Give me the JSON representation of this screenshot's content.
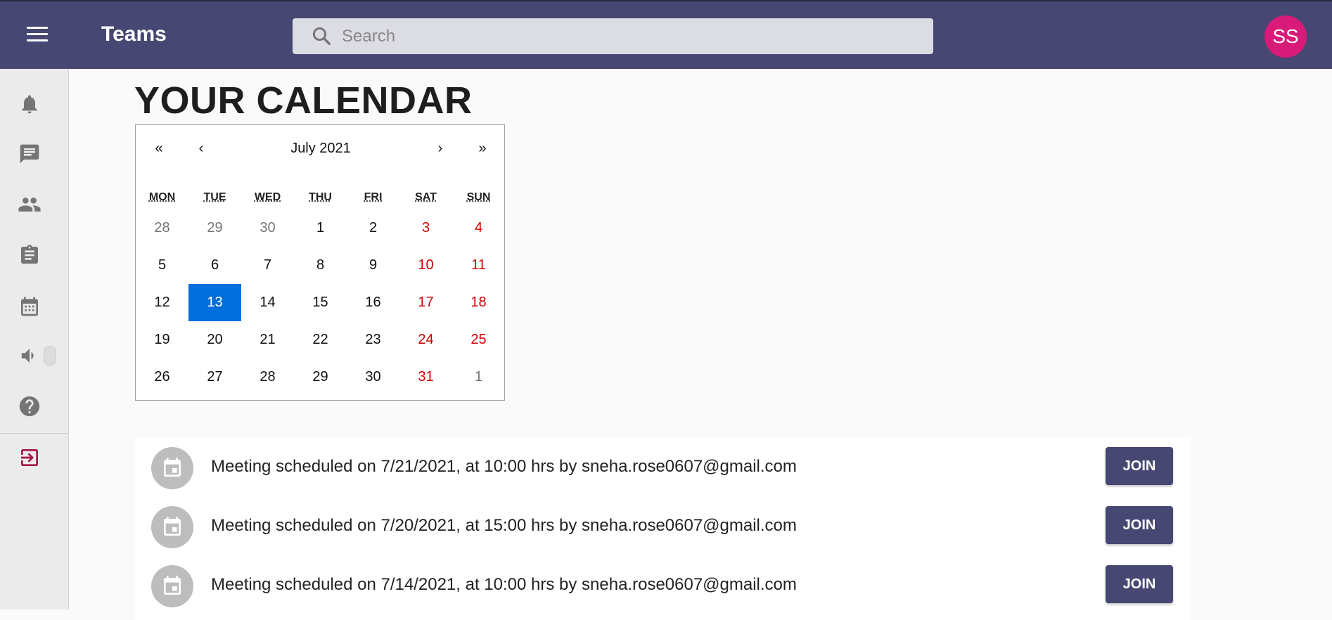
{
  "header": {
    "app_title": "Teams",
    "search_placeholder": "Search",
    "avatar_initials": "SS",
    "bar_color": "#474773",
    "avatar_color": "#d81b78"
  },
  "sidebar": {
    "items": [
      {
        "icon": "bell-icon"
      },
      {
        "icon": "chat-icon"
      },
      {
        "icon": "people-icon"
      },
      {
        "icon": "clipboard-icon"
      },
      {
        "icon": "calendar-icon"
      },
      {
        "icon": "speaker-icon",
        "toggle": "off"
      },
      {
        "icon": "help-icon"
      },
      {
        "icon": "logout-icon",
        "color": "#a31545"
      }
    ]
  },
  "main": {
    "page_title": "YOUR CALENDAR"
  },
  "calendar": {
    "prev_year": "«",
    "prev_month": "‹",
    "month_label": "July 2021",
    "next_month": "›",
    "next_year": "»",
    "weekdays": [
      "MON",
      "TUE",
      "WED",
      "THU",
      "FRI",
      "SAT",
      "SUN"
    ],
    "days": [
      {
        "n": "28",
        "muted": true
      },
      {
        "n": "29",
        "muted": true
      },
      {
        "n": "30",
        "muted": true
      },
      {
        "n": "1"
      },
      {
        "n": "2"
      },
      {
        "n": "3",
        "weekend": true
      },
      {
        "n": "4",
        "weekend": true
      },
      {
        "n": "5"
      },
      {
        "n": "6"
      },
      {
        "n": "7"
      },
      {
        "n": "8"
      },
      {
        "n": "9"
      },
      {
        "n": "10",
        "weekend": true
      },
      {
        "n": "11",
        "weekend": true
      },
      {
        "n": "12"
      },
      {
        "n": "13",
        "selected": true
      },
      {
        "n": "14"
      },
      {
        "n": "15"
      },
      {
        "n": "16"
      },
      {
        "n": "17",
        "weekend": true
      },
      {
        "n": "18",
        "weekend": true
      },
      {
        "n": "19"
      },
      {
        "n": "20"
      },
      {
        "n": "21"
      },
      {
        "n": "22"
      },
      {
        "n": "23"
      },
      {
        "n": "24",
        "weekend": true
      },
      {
        "n": "25",
        "weekend": true
      },
      {
        "n": "26"
      },
      {
        "n": "27"
      },
      {
        "n": "28"
      },
      {
        "n": "29"
      },
      {
        "n": "30"
      },
      {
        "n": "31",
        "weekend": true
      },
      {
        "n": "1",
        "muted": true
      }
    ],
    "selected_color": "#006edc",
    "weekend_color": "#d10000"
  },
  "meetings": [
    {
      "text": "Meeting scheduled on 7/21/2021, at 10:00 hrs by sneha.rose0607@gmail.com",
      "button": "JOIN"
    },
    {
      "text": "Meeting scheduled on 7/20/2021, at 15:00 hrs by sneha.rose0607@gmail.com",
      "button": "JOIN"
    },
    {
      "text": "Meeting scheduled on 7/14/2021, at 10:00 hrs by sneha.rose0607@gmail.com",
      "button": "JOIN"
    }
  ]
}
